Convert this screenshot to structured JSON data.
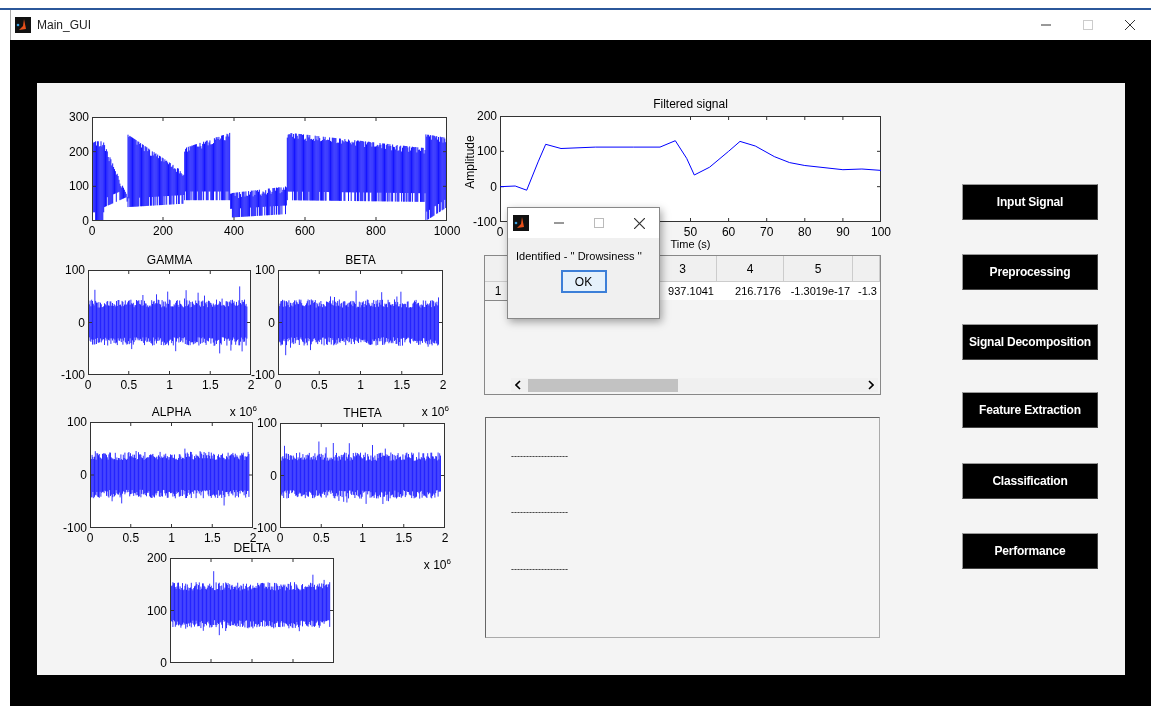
{
  "window": {
    "title": "Main_GUI"
  },
  "overview_plot": {
    "yticks": [
      "300",
      "200",
      "100",
      "0"
    ],
    "xticks": [
      "0",
      "200",
      "400",
      "600",
      "800",
      "1000"
    ]
  },
  "band_plots": [
    {
      "title": "GAMMA",
      "yticks": [
        "100",
        "0",
        "-100"
      ],
      "xticks": [
        "0",
        "0.5",
        "1",
        "1.5",
        "2"
      ],
      "exponent": "x 10$^{6}$"
    },
    {
      "title": "BETA",
      "yticks": [
        "100",
        "0",
        "-100"
      ],
      "xticks": [
        "0",
        "0.5",
        "1",
        "1.5",
        "2"
      ],
      "exponent": "x 10$^{6}$"
    },
    {
      "title": "ALPHA",
      "yticks": [
        "100",
        "0",
        "-100"
      ],
      "xticks": [
        "0",
        "0.5",
        "1",
        "1.5",
        "2"
      ]
    },
    {
      "title": "THETA",
      "yticks": [
        "100",
        "0",
        "-100"
      ],
      "xticks": [
        "0",
        "0.5",
        "1",
        "1.5",
        "2"
      ],
      "exponent": "x 10$^{6}$"
    },
    {
      "title": "DELTA",
      "yticks": [
        "200",
        "100",
        "0"
      ]
    }
  ],
  "filtered_signal": {
    "chart_data": {
      "type": "line",
      "title": "Filtered signal",
      "xlabel": "Time (s)",
      "ylabel": "Amplitude",
      "x": [
        0,
        4,
        7,
        10,
        12,
        16,
        25,
        35,
        42,
        46,
        49,
        51,
        55,
        60,
        63,
        67,
        72,
        76,
        80,
        90,
        95,
        100
      ],
      "series": [
        {
          "color": "#0000ff",
          "values": [
            0,
            2,
            -10,
            70,
            120,
            108,
            112,
            112,
            112,
            130,
            80,
            33,
            55,
            100,
            128,
            115,
            85,
            68,
            60,
            48,
            50,
            46
          ]
        }
      ],
      "xlim": [
        0,
        100
      ],
      "ylim": [
        -100,
        200
      ],
      "xticks": [
        0,
        50,
        60,
        70,
        80,
        90,
        100
      ],
      "yticks": [
        -100,
        0,
        100,
        200
      ]
    }
  },
  "table": {
    "columns": [
      "3",
      "4",
      "5"
    ],
    "rows": [
      {
        "header": "1",
        "cells": [
          "937.1041",
          "216.7176",
          "-1.3019e-17",
          "-1.3"
        ]
      }
    ]
  },
  "result_panel": {
    "lines": [
      "-------------------",
      "-------------------",
      "-------------------"
    ]
  },
  "buttons": [
    "Input Signal",
    "Preprocessing",
    "Signal Decomposition",
    "Feature Extraction",
    "Classification",
    "Performance"
  ],
  "dialog": {
    "message": "Identified - '' Drowsiness ''",
    "button": "OK"
  }
}
